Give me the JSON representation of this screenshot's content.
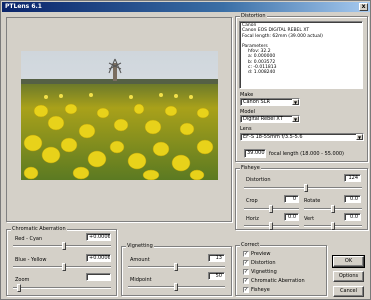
{
  "title": "PTLens 6.1",
  "close_glyph": "x",
  "distortion": {
    "group_label": "Distortion",
    "camera_lines": [
      "Canon",
      "Canon EOS DIGITAL REBEL XT",
      "Focal length: 62mm (39.000 actual)"
    ],
    "params_header": "Parameters",
    "params": [
      "hfov: 32.2",
      "a: 0.000000",
      "b: 0.003572",
      "c: -0.011813",
      "d: 1.008240"
    ]
  },
  "make": {
    "label": "Make",
    "value": "Canon SLR"
  },
  "model": {
    "label": "Model",
    "value": "Digital Rebel XT"
  },
  "lens": {
    "label": "Lens",
    "value": "EF-S 18-55mm f/3.5-5.6"
  },
  "focal": {
    "value": "39.000",
    "label": "focal length (18.000 - 55.000)"
  },
  "fisheye": {
    "group_label": "Fisheye",
    "distortion_label": "Distortion",
    "distortion_value": "124",
    "crop_label": "Crop",
    "crop_value": "0",
    "rotate_label": "Rotate",
    "rotate_value": "0.0",
    "horiz_label": "Horiz",
    "horiz_value": "0.0",
    "vert_label": "Vert",
    "vert_value": "0.0"
  },
  "chromatic": {
    "group_label": "Chromatic Aberration",
    "red_label": "Red - Cyan",
    "red_value": "+0.0006",
    "blue_label": "Blue - Yellow",
    "blue_value": "+0.0006",
    "zoom_label": "Zoom",
    "zoom_value": ""
  },
  "vignetting": {
    "group_label": "Vignetting",
    "amount_label": "Amount",
    "amount_value": "13",
    "midpoint_label": "Midpoint",
    "midpoint_value": "50"
  },
  "correct": {
    "group_label": "Correct",
    "items": [
      "Preview",
      "Distortion",
      "Vignetting",
      "Chromatic Aberration",
      "Fisheye"
    ],
    "check": "✓"
  },
  "buttons": {
    "ok": "OK",
    "options": "Options",
    "cancel": "Cancel"
  }
}
